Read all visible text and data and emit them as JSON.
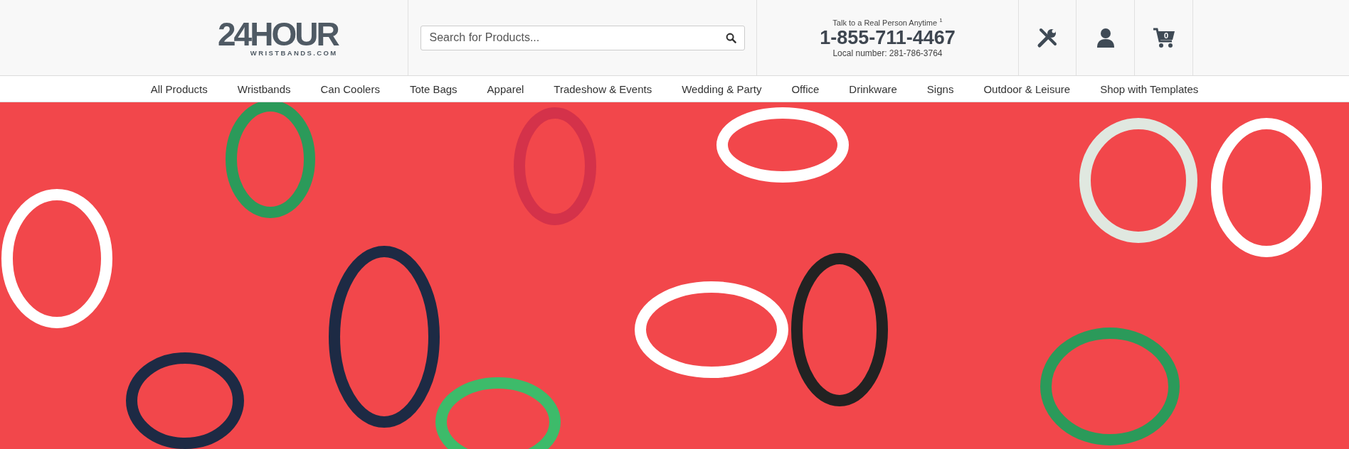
{
  "header": {
    "logo": {
      "main": "24HOUR",
      "sub": "WRISTBANDS.COM"
    },
    "search": {
      "placeholder": "Search for Products..."
    },
    "contact": {
      "tagline": "Talk to a Real Person Anytime $^{1}$",
      "phone": "1-855-711-4467",
      "local": "Local number: 281-786-3764"
    },
    "icons": [
      {
        "kind": "tools"
      },
      {
        "kind": "account"
      },
      {
        "kind": "cart",
        "badge": "0"
      }
    ]
  },
  "nav": [
    {
      "label": "All Products"
    },
    {
      "label": "Wristbands"
    },
    {
      "label": "Can Coolers"
    },
    {
      "label": "Tote Bags"
    },
    {
      "label": "Apparel"
    },
    {
      "label": "Tradeshow & Events"
    },
    {
      "label": "Wedding & Party"
    },
    {
      "label": "Office"
    },
    {
      "label": "Drinkware"
    },
    {
      "label": "Signs"
    },
    {
      "label": "Outdoor & Leisure"
    },
    {
      "label": "Shop with Templates"
    }
  ]
}
